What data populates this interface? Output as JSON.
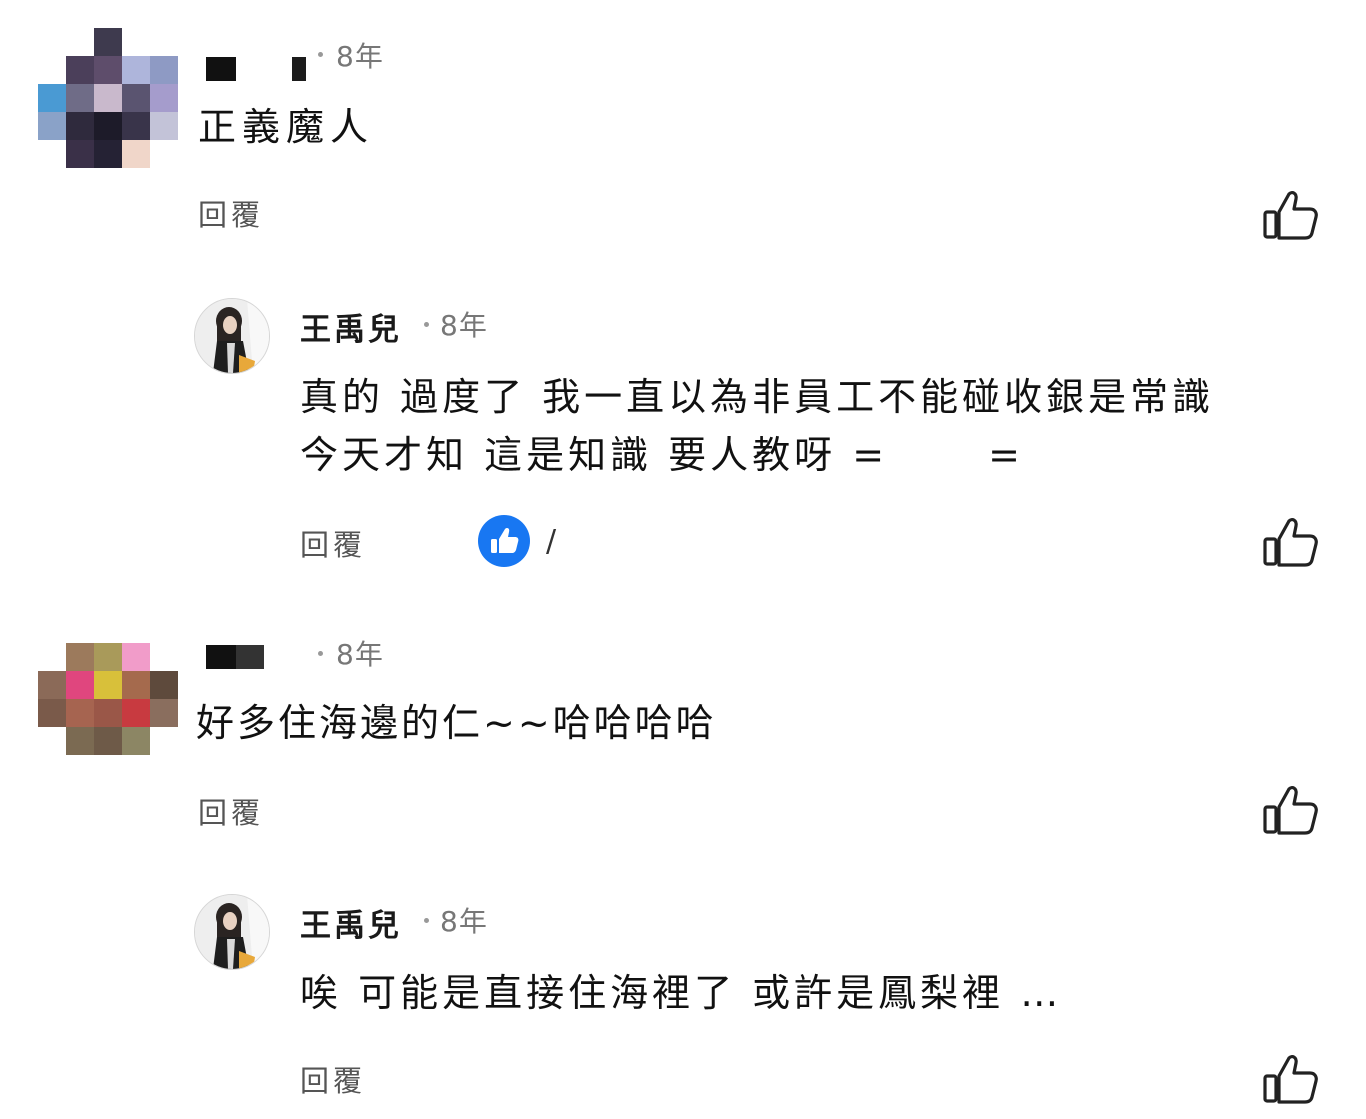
{
  "comments": [
    {
      "author": "",
      "time": "8年",
      "text": "正義魔人",
      "reply_label": "回覆"
    },
    {
      "author": "王禹兒",
      "time": "8年",
      "text_line1": "真的 過度了 我一直以為非員工不能碰收銀是常識",
      "text_line2": "今天才知 這是知識 要人教呀 =　　 =",
      "reply_label": "回覆",
      "reaction_icon": "thumbs-up-icon",
      "reaction_count": "/"
    },
    {
      "author": "",
      "time": "8年",
      "text": "好多住海邊的仁~~哈哈哈哈",
      "reply_label": "回覆"
    },
    {
      "author": "王禹兒",
      "time": "8年",
      "text": "唉 可能是直接住海裡了 或許是鳳梨裡 …",
      "reply_label": "回覆"
    }
  ],
  "like_icon": "thumbs-up-outline-icon",
  "colors": {
    "reaction_blue": "#1877f2",
    "secondary_text": "#777777"
  }
}
